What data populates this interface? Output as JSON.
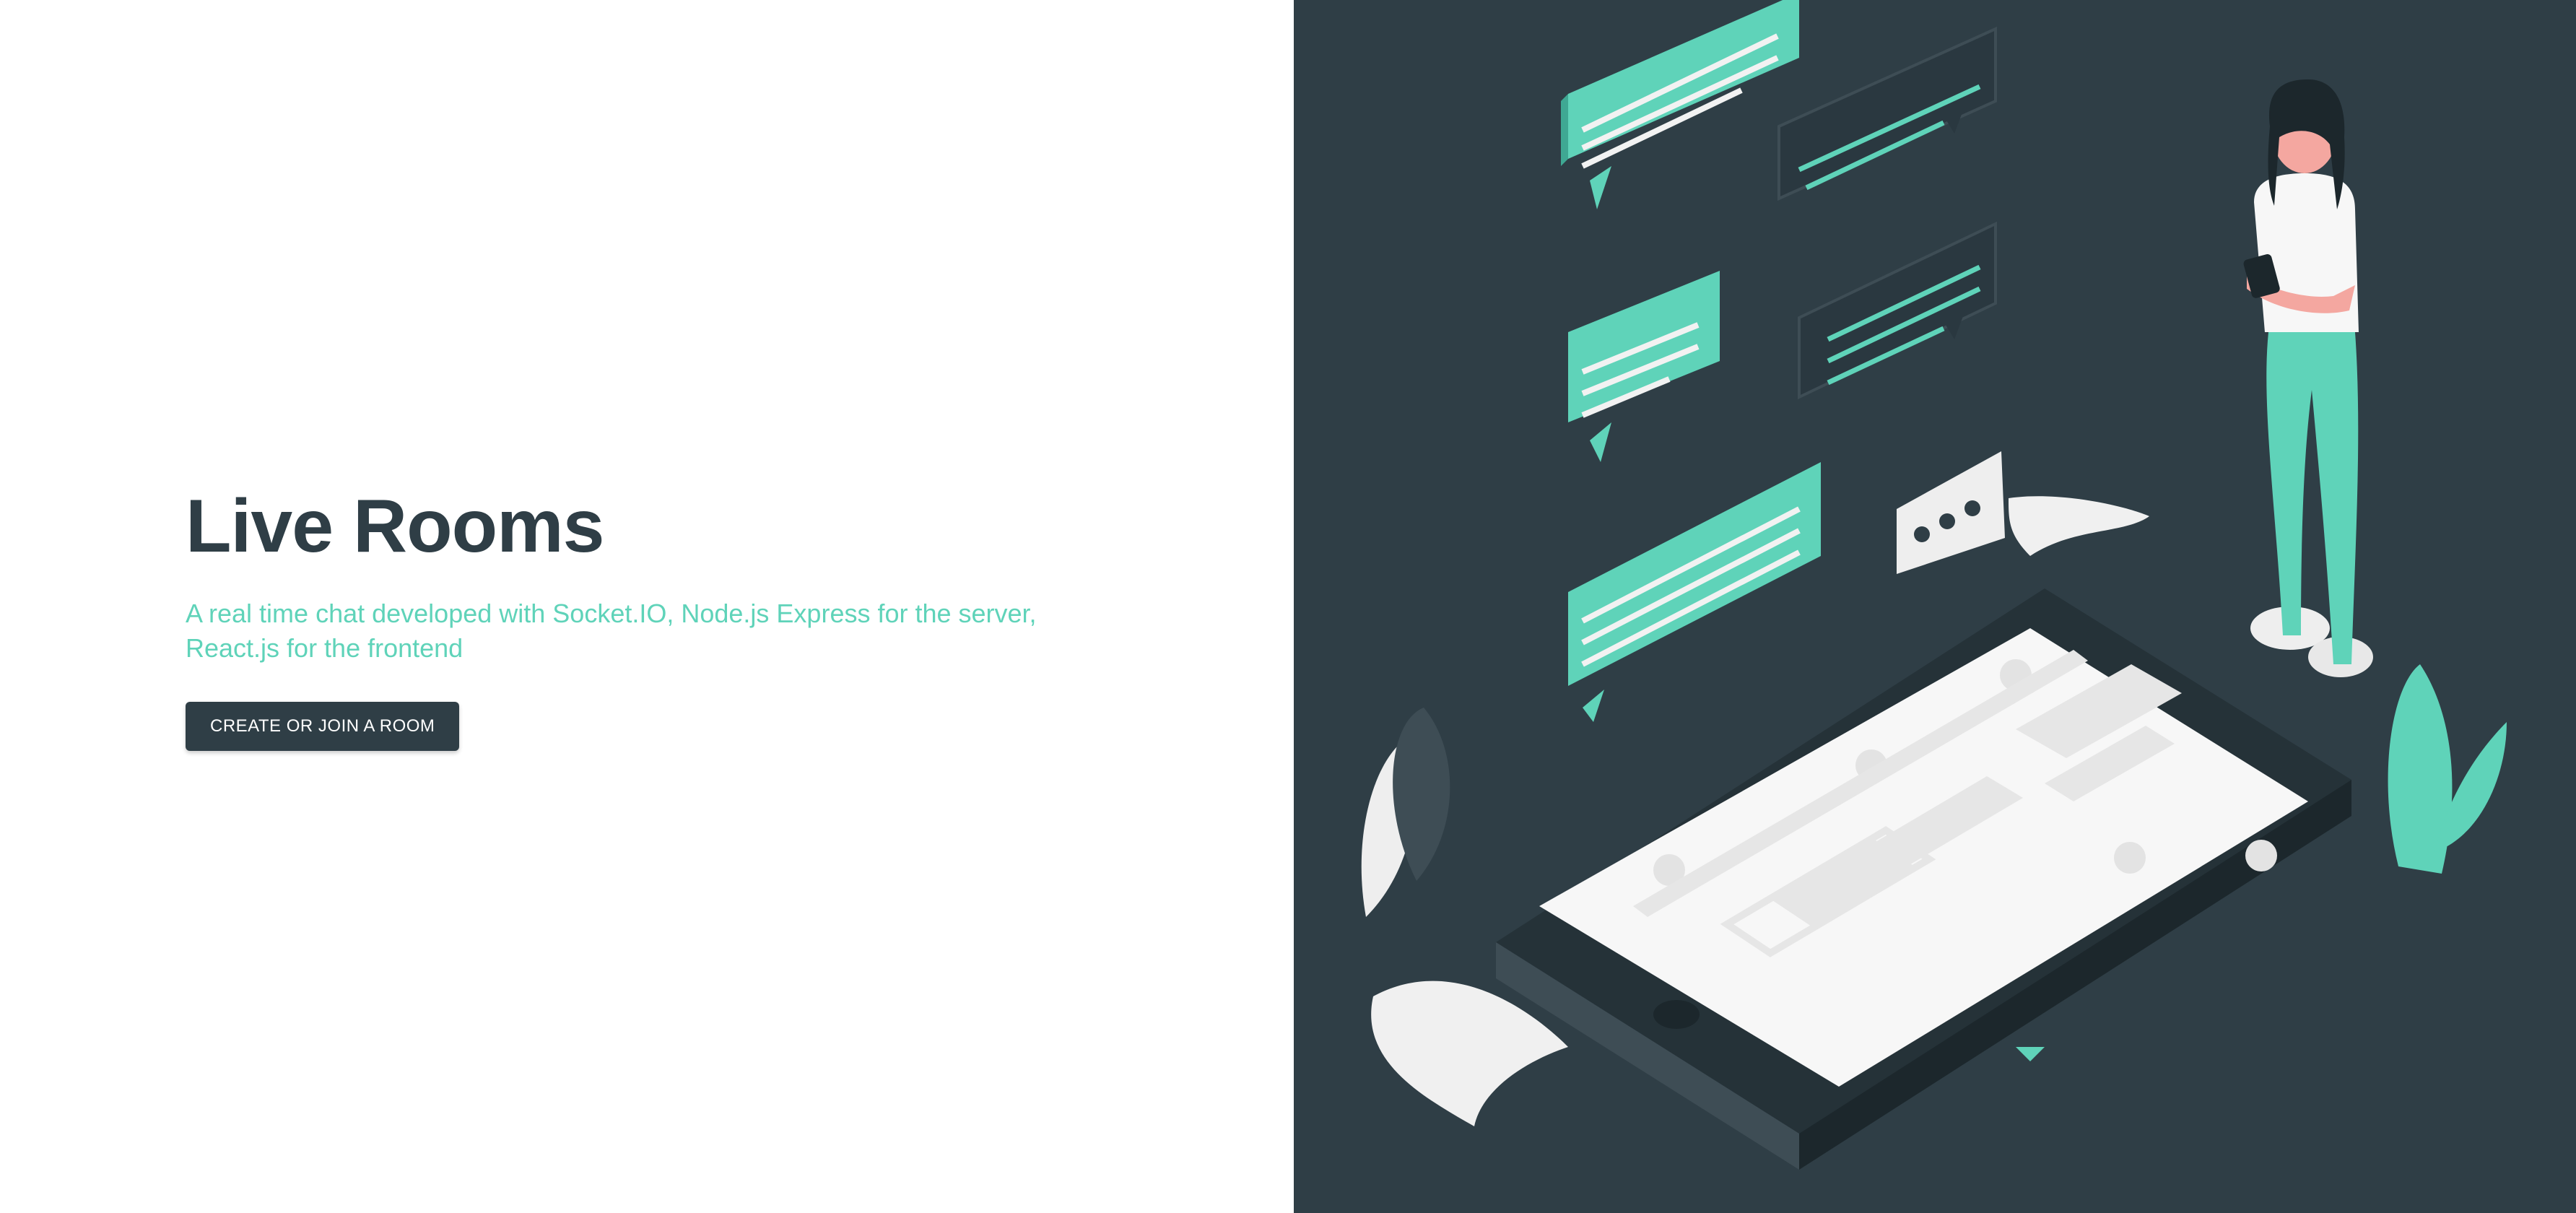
{
  "hero": {
    "title": "Live Rooms",
    "description": "A real time chat developed with Socket.IO, Node.js Express for the server, React.js for the frontend",
    "cta_label": "CREATE OR JOIN A ROOM"
  },
  "colors": {
    "dark": "#2f3e46",
    "accent": "#5fd3b9",
    "background": "#ffffff"
  },
  "illustration": {
    "icon": "chat-illustration"
  }
}
